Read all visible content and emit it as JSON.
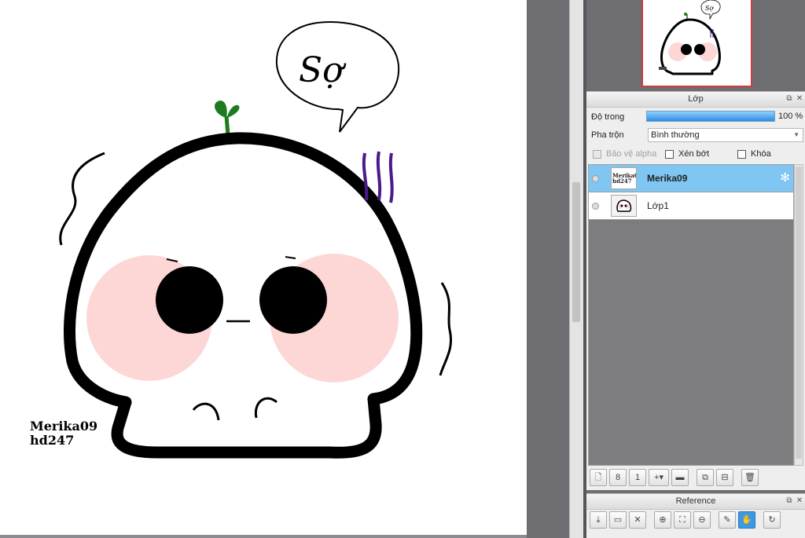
{
  "canvas": {
    "speech_bubble_text": "Sợ",
    "signature_line1": "Merika09",
    "signature_line2": "hd247",
    "colors": {
      "outline": "#000000",
      "blush": "#fdd6d6",
      "sprout": "#1e7b1e",
      "shiver": "#4b1a8a"
    }
  },
  "navigator": {
    "bubble_text": "Sợ"
  },
  "layer_panel": {
    "title": "Lớp",
    "opacity_label": "Độ trong",
    "opacity_value": "100 %",
    "opacity_fraction": 1.0,
    "blend_label": "Pha trộn",
    "blend_value": "Bình thường",
    "protect_alpha_label": "Bảo vệ alpha",
    "clipping_label": "Xén bớt",
    "lock_label": "Khóa",
    "layers": [
      {
        "name": "Merika09",
        "selected": true,
        "thumb_text": "Merika09 hd247"
      },
      {
        "name": "Lớp1",
        "selected": false
      }
    ],
    "toolbar": [
      "new-layer-icon",
      "new-8bit-layer-icon",
      "new-1bit-layer-icon",
      "add-layer-dropdown-icon",
      "folder-icon",
      "duplicate-icon",
      "merge-icon",
      "delete-icon"
    ]
  },
  "reference_panel": {
    "title": "Reference",
    "toolbar": [
      "import-icon",
      "open-folder-icon",
      "close-icon",
      "zoom-in-icon",
      "fit-icon",
      "zoom-out-icon",
      "eyedropper-icon",
      "hand-icon",
      "rotate-icon"
    ]
  },
  "accent_color": "#3a9be4"
}
